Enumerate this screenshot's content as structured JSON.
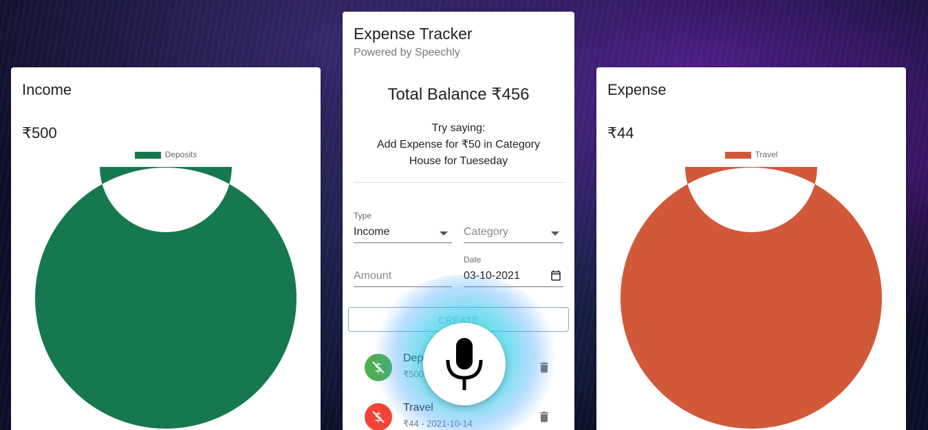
{
  "income": {
    "title": "Income",
    "amount": "₹500",
    "legend_label": "Deposits",
    "color": "#16784F"
  },
  "expense": {
    "title": "Expense",
    "amount": "₹44",
    "legend_label": "Travel",
    "color": "#D2583A"
  },
  "tracker": {
    "title": "Expense Tracker",
    "subtitle": "Powered by Speechly",
    "balance": "Total Balance ₹456",
    "try_saying": "Try saying:",
    "hint_line1": "Add Expense for ₹50 in Category",
    "hint_line2": "House for Tueseday",
    "form": {
      "type_label": "Type",
      "type_value": "Income",
      "category_placeholder": "Category",
      "amount_placeholder": "Amount",
      "date_label": "Date",
      "date_value": "03-10-2021",
      "create_label": "CREATE"
    },
    "transactions": [
      {
        "title": "Deposits",
        "detail": "₹500 - 2021-10-14",
        "color": "#4CAF50"
      },
      {
        "title": "Travel",
        "detail": "₹44 - 2021-10-14",
        "color": "#F44336"
      }
    ]
  },
  "chart_data": [
    {
      "type": "pie",
      "categories": [
        "Deposits"
      ],
      "values": [
        500
      ],
      "colors": [
        "#16784F"
      ],
      "legend": "top-center"
    },
    {
      "type": "pie",
      "categories": [
        "Travel"
      ],
      "values": [
        44
      ],
      "colors": [
        "#D2583A"
      ],
      "legend": "top-center"
    }
  ]
}
